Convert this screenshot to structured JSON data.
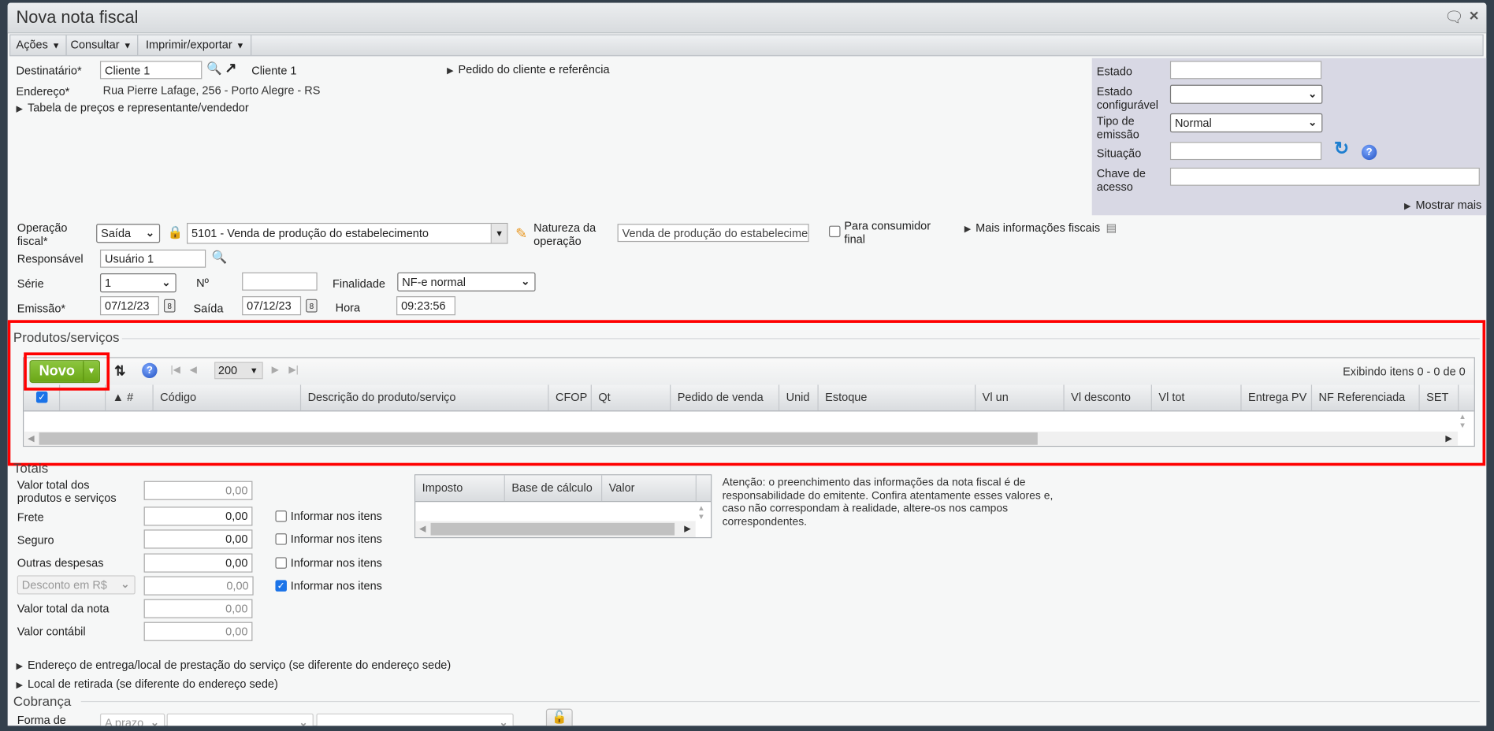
{
  "window": {
    "title": "Nova nota fiscal"
  },
  "menu": [
    {
      "label": "Ações"
    },
    {
      "label": "Consultar"
    },
    {
      "label": "Imprimir/exportar"
    }
  ],
  "header": {
    "destinatario_label": "Destinatário*",
    "destinatario_value": "Cliente 1",
    "destinatario_link": "Cliente 1",
    "endereco_label": "Endereço*",
    "endereco_value": "Rua Pierre Lafage, 256 - Porto Alegre - RS",
    "tabela_precos": "Tabela de preços e representante/vendedor",
    "pedido_cliente": "Pedido do cliente e referência"
  },
  "status_panel": {
    "estado_label": "Estado",
    "estado_value": "",
    "estado_config_label1": "Estado",
    "estado_config_label2": "configurável",
    "estado_config_value": "",
    "tipo_emissao_label1": "Tipo de",
    "tipo_emissao_label2": "emissão",
    "tipo_emissao_value": "Normal",
    "situacao_label": "Situação",
    "situacao_value": "",
    "chave_label1": "Chave de",
    "chave_label2": "acesso",
    "chave_value": "",
    "mostrar_mais": "Mostrar mais"
  },
  "fiscal": {
    "operacao_label1": "Operação",
    "operacao_label2": "fiscal*",
    "operacao_tipo": "Saída",
    "cfop": "5101 - Venda de produção do estabelecimento",
    "natureza_label1": "Natureza da",
    "natureza_label2": "operação",
    "natureza_value": "Venda de produção do estabelecimento",
    "consumidor_label1": "Para consumidor",
    "consumidor_label2": "final",
    "mais_info": "Mais informações fiscais",
    "responsavel_label": "Responsável",
    "responsavel_value": "Usuário 1",
    "serie_label": "Série",
    "serie_value": "1",
    "numero_label": "Nº",
    "numero_value": "",
    "finalidade_label": "Finalidade",
    "finalidade_value": "NF-e normal",
    "emissao_label": "Emissão*",
    "emissao_value": "07/12/23",
    "saida_label": "Saída",
    "saida_value": "07/12/23",
    "hora_label": "Hora",
    "hora_value": "09:23:56"
  },
  "produtos": {
    "legend": "Produtos/serviços",
    "novo_label": "Novo",
    "page_size": "200",
    "paging_info": "Exibindo itens 0 - 0 de 0",
    "columns": [
      "",
      "",
      "▲ #",
      "Código",
      "Descrição do produto/serviço",
      "CFOP",
      "Qt",
      "Pedido de venda",
      "Unid",
      "Estoque",
      "Vl un",
      "Vl desconto",
      "Vl tot",
      "Entrega PV",
      "NF Referenciada",
      "SET"
    ]
  },
  "totais": {
    "legend": "Totais",
    "valor_produtos_label1": "Valor total dos",
    "valor_produtos_label2": "produtos e serviços",
    "valor_produtos": "0,00",
    "frete_label": "Frete",
    "frete": "0,00",
    "seguro_label": "Seguro",
    "seguro": "0,00",
    "outras_label": "Outras despesas",
    "outras": "0,00",
    "desconto_tipo": "Desconto em R$",
    "desconto": "0,00",
    "valor_nota_label": "Valor total da nota",
    "valor_nota": "0,00",
    "valor_contabil_label": "Valor contábil",
    "valor_contabil": "0,00",
    "informar_label": "Informar nos itens",
    "informar_checked": [
      false,
      false,
      false,
      true
    ],
    "impostos_columns": [
      "Imposto",
      "Base de cálculo",
      "Valor"
    ],
    "atencao": "Atenção: o preenchimento das informações da nota fiscal é de responsabilidade do emitente. Confira atentamente esses valores e, caso não correspondam à realidade, altere-os nos campos correspondentes."
  },
  "sections": {
    "endereco_entrega": "Endereço de entrega/local de prestação do serviço (se diferente do endereço sede)",
    "local_retirada": "Local de retirada (se diferente do endereço sede)"
  },
  "cobranca": {
    "legend": "Cobrança",
    "forma_label": "Forma de",
    "forma_value": "A prazo"
  },
  "colors": {
    "accent_green": "#7cb518",
    "highlight_red": "#ff0000",
    "panel": "#d8d8e4"
  }
}
